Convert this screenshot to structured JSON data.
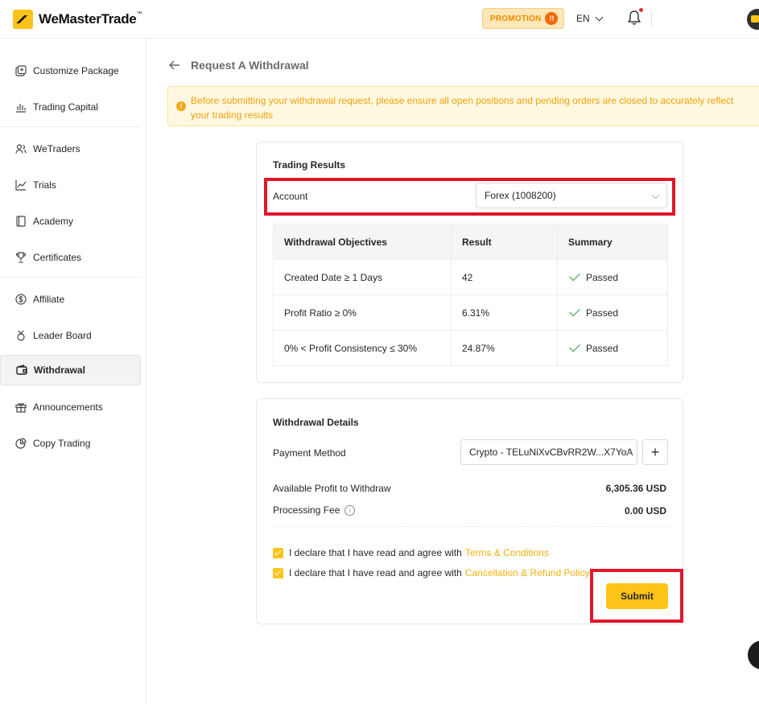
{
  "header": {
    "brand": "WeMasterTrade",
    "trademark": "™",
    "promotion_label": "PROMOTION",
    "promotion_badge": "!!",
    "language": "EN"
  },
  "sidebar": {
    "items": [
      {
        "label": "Customize Package",
        "icon": "customize-icon"
      },
      {
        "label": "Trading Capital",
        "icon": "capital-icon"
      },
      {
        "label": "WeTraders",
        "icon": "users-icon"
      },
      {
        "label": "Trials",
        "icon": "chart-line-icon"
      },
      {
        "label": "Academy",
        "icon": "book-icon"
      },
      {
        "label": "Certificates",
        "icon": "trophy-icon"
      },
      {
        "label": "Affiliate",
        "icon": "dollar-icon"
      },
      {
        "label": "Leader Board",
        "icon": "medal-icon"
      },
      {
        "label": "Withdrawal",
        "icon": "wallet-icon",
        "active": true
      },
      {
        "label": "Announcements",
        "icon": "gift-icon"
      },
      {
        "label": "Copy Trading",
        "icon": "pie-icon"
      }
    ]
  },
  "page": {
    "title": "Request A Withdrawal",
    "notice": "Before submitting your withdrawal request, please ensure all open positions and pending orders are closed to accurately reflect your trading results",
    "notice_icon": "!"
  },
  "trading_results": {
    "title": "Trading Results",
    "account_label": "Account",
    "account_value": "Forex (1008200)",
    "columns": [
      "Withdrawal Objectives",
      "Result",
      "Summary"
    ],
    "rows": [
      {
        "objective": "Created Date ≥ 1 Days",
        "result": "42",
        "summary": "Passed"
      },
      {
        "objective": "Profit Ratio ≥ 0%",
        "result": "6.31%",
        "summary": "Passed"
      },
      {
        "objective": "0% < Profit Consistency ≤ 30%",
        "result": "24.87%",
        "summary": "Passed"
      }
    ]
  },
  "withdrawal_details": {
    "title": "Withdrawal Details",
    "payment_method_label": "Payment Method",
    "payment_method_value": "Crypto - TELuNiXvCBvRR2W...X7YoA",
    "add_label": "+",
    "available_label": "Available Profit to Withdraw",
    "available_value": "6,305.36 USD",
    "fee_label": "Processing Fee",
    "fee_info": "i",
    "fee_value": "0.00 USD",
    "agree_prefix": "I declare that I have read and agree with",
    "terms_link": "Terms & Conditions",
    "refund_link": "Cancellation & Refund Policy",
    "submit_label": "Submit"
  },
  "colors": {
    "accent": "#fcc419",
    "highlight": "#e0162b",
    "success": "#2f9e44"
  }
}
